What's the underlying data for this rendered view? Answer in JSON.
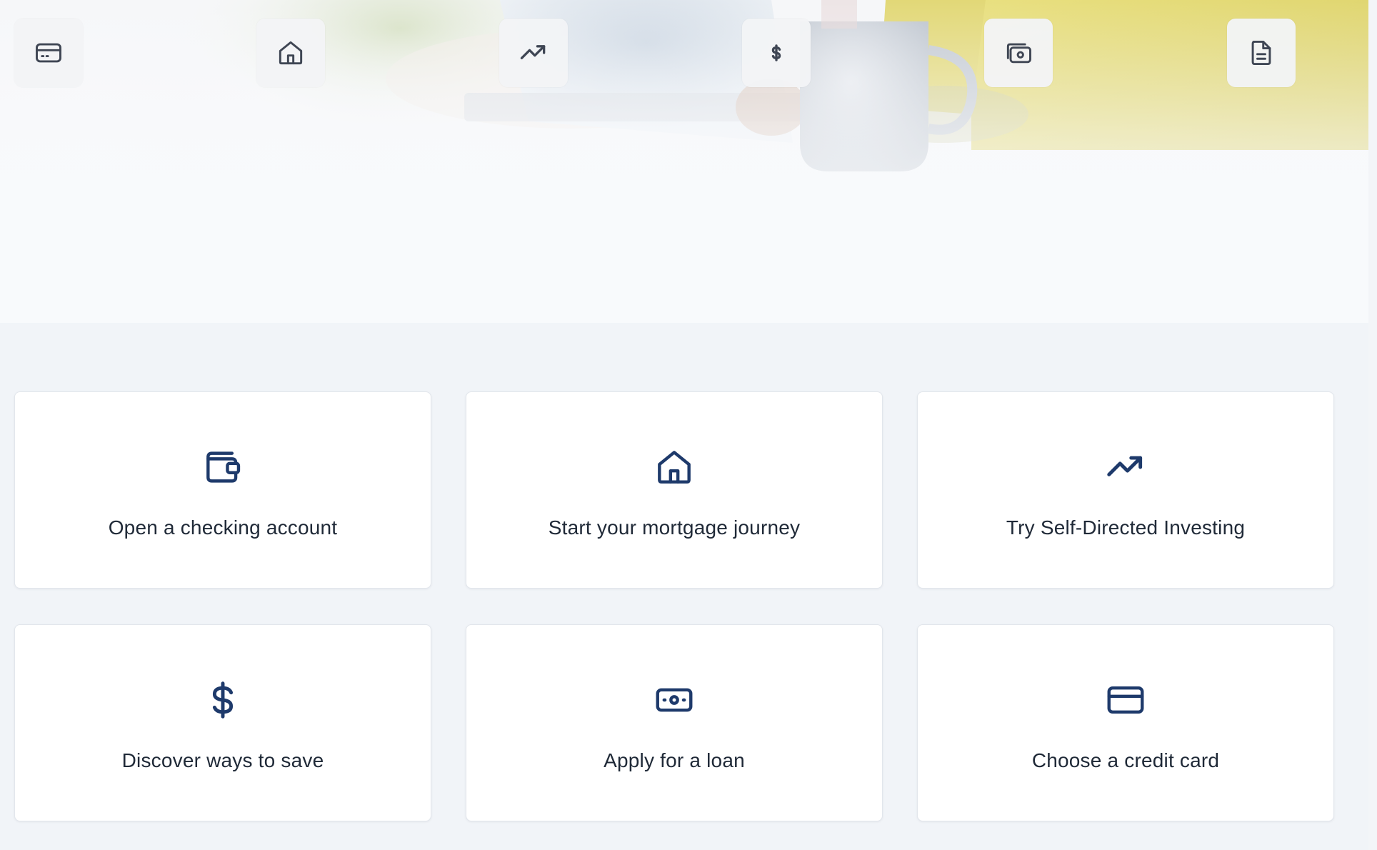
{
  "colors": {
    "icon_primary": "#1e3a6b",
    "icon_muted": "#3f4654",
    "card_background": "#ffffff",
    "page_background": "#f1f4f8",
    "quick_button_background": "#f3f4f6"
  },
  "hero": {
    "image": "person-at-laptop-with-mug",
    "quick_actions": [
      {
        "icon": "credit-card-icon"
      },
      {
        "icon": "home-icon"
      },
      {
        "icon": "trending-up-icon"
      },
      {
        "icon": "dollar-icon"
      },
      {
        "icon": "cash-icon"
      },
      {
        "icon": "document-icon"
      }
    ]
  },
  "cards": [
    {
      "icon": "wallet-icon",
      "label": "Open a checking account"
    },
    {
      "icon": "home-icon",
      "label": "Start your mortgage journey"
    },
    {
      "icon": "trending-up-icon",
      "label": "Try Self-Directed Investing"
    },
    {
      "icon": "dollar-icon",
      "label": "Discover ways to save"
    },
    {
      "icon": "cash-icon",
      "label": "Apply for a loan"
    },
    {
      "icon": "credit-card-icon",
      "label": "Choose a credit card"
    }
  ]
}
